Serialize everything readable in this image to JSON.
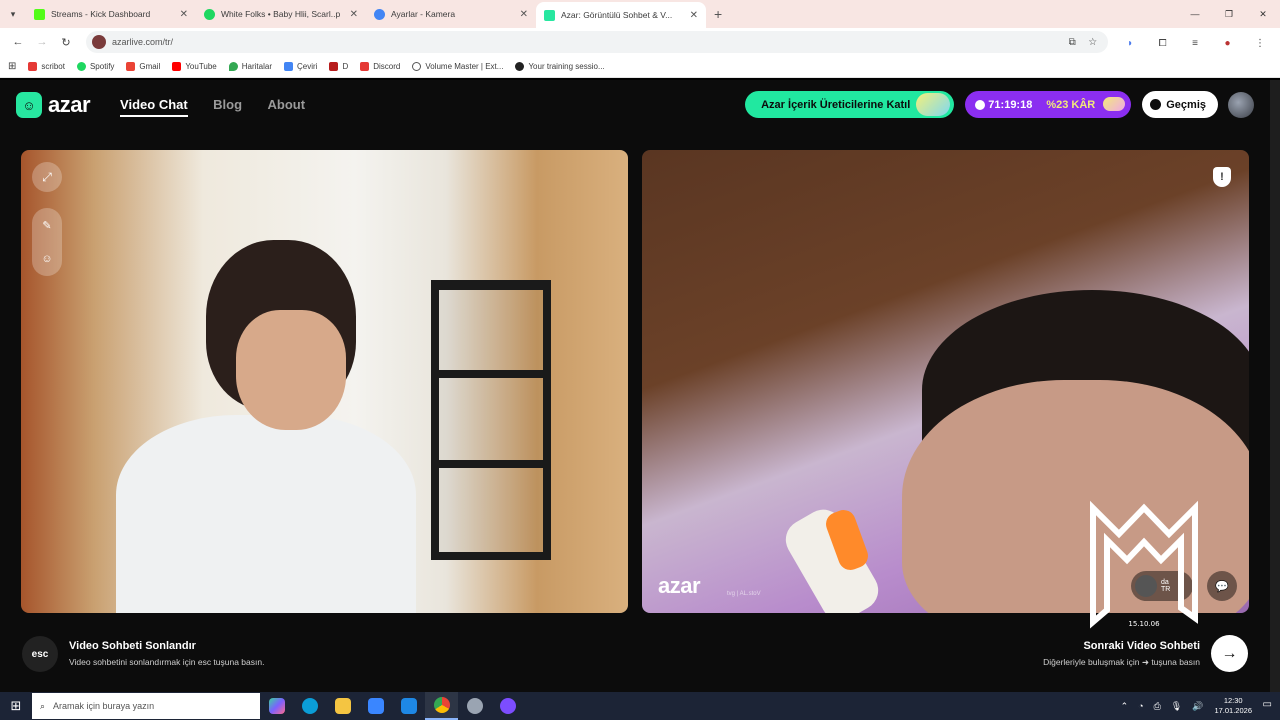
{
  "browser": {
    "tabs": [
      {
        "title": "Streams - Kick Dashboard",
        "color": "#53fc18",
        "active": false
      },
      {
        "title": "White Folks • Baby Hlii, Scarl..p",
        "color": "#1ed760",
        "active": false
      },
      {
        "title": "Ayarlar - Kamera",
        "color": "#4285f4",
        "active": false
      },
      {
        "title": "Azar: Görüntülü Sohbet & V...",
        "color": "#27e7a0",
        "active": true
      }
    ],
    "url": "azarlive.com/tr/",
    "bookmarks": [
      {
        "label": "scribot",
        "color": "#e53935"
      },
      {
        "label": "Spotify",
        "color": "#1ed760"
      },
      {
        "label": "Gmail",
        "color": "#ea4335"
      },
      {
        "label": "YouTube",
        "color": "#ff0000"
      },
      {
        "label": "Haritalar",
        "color": "#34a853"
      },
      {
        "label": "Çeviri",
        "color": "#4285f4"
      },
      {
        "label": "D",
        "color": "#b71c1c"
      },
      {
        "label": "Discord",
        "color": "#e53935"
      },
      {
        "label": "Volume Master | Ext...",
        "color": "#ffffff"
      },
      {
        "label": "Your training sessio...",
        "color": "#222222"
      }
    ]
  },
  "site": {
    "logo_text": "azar",
    "nav": [
      "Video Chat",
      "Blog",
      "About"
    ],
    "promo": "Azar İçerik Üreticilerine Katıl",
    "offer_timer": "71:19:18",
    "offer_discount": "%23 KÂR",
    "history": "Geçmiş"
  },
  "videos": {
    "watermark": "azar",
    "watermark_sub": "tvg | AL.stoV",
    "partner_country": "TR",
    "partner_label": "da"
  },
  "footer": {
    "esc_key": "esc",
    "end_title": "Video Sohbeti Sonlandır",
    "end_sub": "Video sohbetini sonlandırmak için esc tuşuna basın.",
    "next_title": "Sonraki Video Sohbeti",
    "next_sub": "Diğerleriyle buluşmak için ➜ tuşuna basın"
  },
  "taskbar": {
    "search_placeholder": "Aramak için buraya yazın",
    "time": "12:30",
    "date": "17.01.2026",
    "apps": [
      {
        "name": "copilot",
        "color": "#7b61ff"
      },
      {
        "name": "edge",
        "color": "#0b9dd6"
      },
      {
        "name": "explorer",
        "color": "#f4c542"
      },
      {
        "name": "store",
        "color": "#3a86ff"
      },
      {
        "name": "mail",
        "color": "#1e88e5"
      },
      {
        "name": "chrome",
        "color": "#ea4335"
      },
      {
        "name": "steam",
        "color": "#9aa4b2"
      },
      {
        "name": "obs",
        "color": "#7c4dff"
      }
    ]
  },
  "overlay_signature": "15.10.06"
}
